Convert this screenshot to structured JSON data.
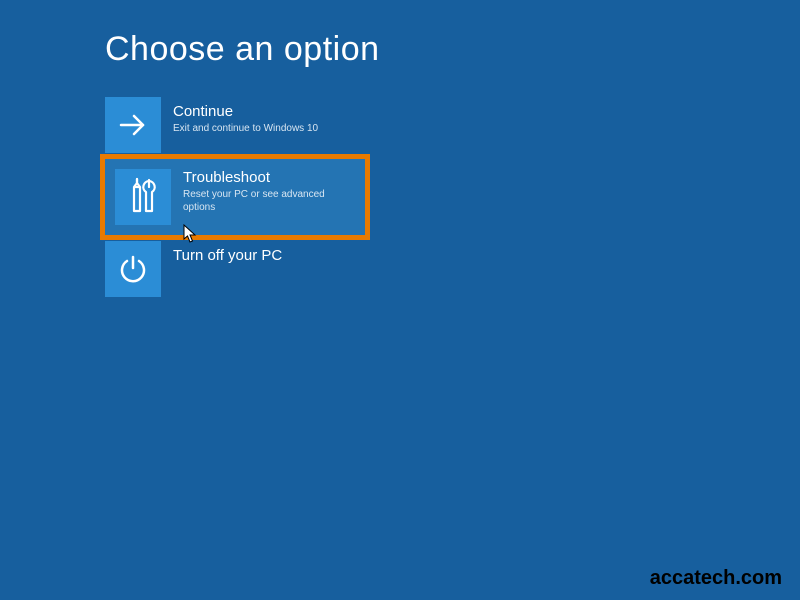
{
  "title": "Choose an option",
  "options": [
    {
      "icon": "arrow-right",
      "label": "Continue",
      "desc": "Exit and continue to Windows 10"
    },
    {
      "icon": "tools",
      "label": "Troubleshoot",
      "desc": "Reset your PC or see advanced options"
    },
    {
      "icon": "power",
      "label": "Turn off your PC",
      "desc": ""
    }
  ],
  "watermark": "accatech.com",
  "colors": {
    "background": "#175f9e",
    "tile": "#2b8dd6",
    "hover": "#2474b3",
    "highlight_border": "#e87a00"
  }
}
